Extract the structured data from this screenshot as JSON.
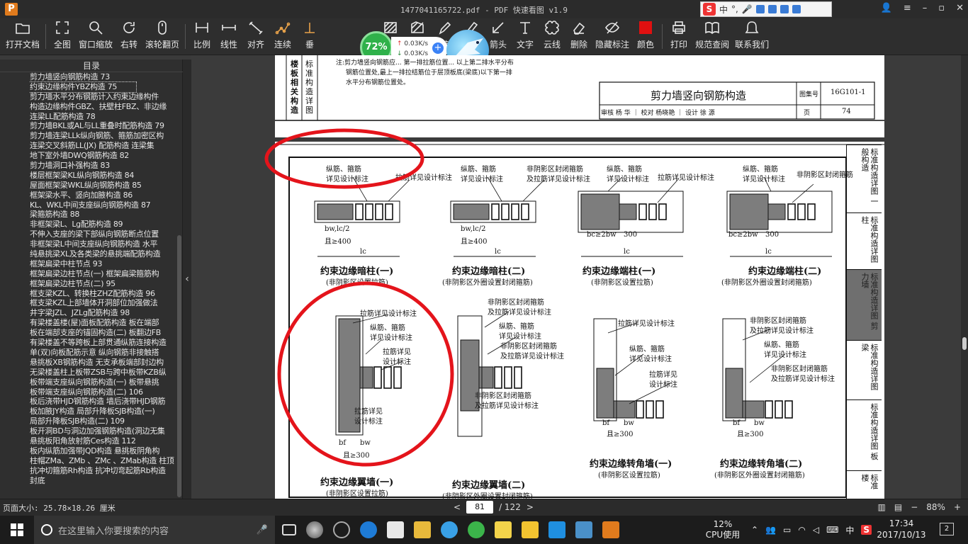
{
  "app": {
    "logo": "P",
    "title": "1477041165722.pdf - PDF 快速看图 v1.9"
  },
  "ime": {
    "brand": "S",
    "mode": "中",
    "punct": "°,"
  },
  "toolbar": {
    "buttons": [
      {
        "label": "打开文档",
        "icon": "folder-icon"
      },
      {
        "label": "全图",
        "icon": "fit-all-icon"
      },
      {
        "label": "窗口缩放",
        "icon": "zoom-window-icon"
      },
      {
        "label": "右转",
        "icon": "rotate-right-icon"
      },
      {
        "label": "滚轮翻页",
        "icon": "mouse-wheel-icon"
      },
      {
        "label": "比例",
        "icon": "scale-icon"
      },
      {
        "label": "线性",
        "icon": "linear-measure-icon"
      },
      {
        "label": "对齐",
        "icon": "align-measure-icon"
      },
      {
        "label": "连续",
        "icon": "continuous-measure-icon"
      },
      {
        "label": "垂",
        "icon": "perpendicular-icon"
      },
      {
        "label": "角度",
        "icon": "angle-icon"
      },
      {
        "label": "弧长",
        "icon": "arc-length-icon"
      },
      {
        "label": "面积",
        "icon": "area-icon"
      },
      {
        "label": "异形",
        "icon": "irregular-shape-icon"
      },
      {
        "label": "画笔",
        "icon": "pen-icon"
      },
      {
        "label": "高亮",
        "icon": "highlighter-icon"
      },
      {
        "label": "箭头",
        "icon": "arrow-icon"
      },
      {
        "label": "文字",
        "icon": "text-icon"
      },
      {
        "label": "云线",
        "icon": "cloud-line-icon"
      },
      {
        "label": "删除",
        "icon": "eraser-icon"
      },
      {
        "label": "隐藏标注",
        "icon": "hide-annotation-icon"
      },
      {
        "label": "颜色",
        "icon": "color-icon"
      },
      {
        "label": "打印",
        "icon": "printer-icon"
      },
      {
        "label": "规范查阅",
        "icon": "book-icon"
      },
      {
        "label": "联系我们",
        "icon": "contact-icon"
      }
    ],
    "color_value": "#e01010"
  },
  "speed_widget": {
    "percent": "72%",
    "up": "0.03K/s",
    "down": "0.03K/s",
    "plus": "+"
  },
  "sidebar": {
    "title": "目录",
    "items": [
      "剪力墙竖向钢筋构造 73",
      "约束边缘构件YBZ构造 75",
      "剪力墙水平分布钢筋计入约束边缘构件",
      "构造边缘构件GBZ、扶壁柱FBZ、非边缘",
      "连梁LL配筋构造 78",
      "剪力墙BKL或AL与LL重叠时配筋构造 79",
      "剪力墙连梁LLk纵向钢筋、箍筋加密区构",
      "连梁交叉斜筋LL(JX) 配筋构造 连梁集",
      "地下室外墙DWQ钢筋构造 82",
      "剪力墙洞口补强构造 83",
      "楼层框架梁KL纵向钢筋构造 84",
      "屋面框架梁WKL纵向钢筋构造 85",
      "框架梁水平、竖向加腋构造 86",
      "KL、WKL中间支座纵向钢筋构造 87",
      "梁箍筋构造 88",
      "非框架梁L、Lg配筋构造 89",
      "不伸入支座的梁下部纵向钢筋断点位置",
      "非框架梁L中间支座纵向钢筋构造 水平",
      "纯悬挑梁XL及各类梁的悬挑端配筋构造",
      "框架扁梁中柱节点 93",
      "框架扁梁边柱节点(一) 框架扁梁箍筋构",
      "框架扁梁边柱节点(二) 95",
      "框支梁KZL、转换柱ZHZ配筋构造 96",
      "框支梁KZL上部墙体开洞部位加强做法",
      "井字梁JZL、JZLg配筋构造 98",
      "有梁楼盖楼(屋)面板配筋构造 板在端部",
      "板在端部支座的锚固构造(二) 板翻边FB",
      "有梁楼盖不等跨板上部贯通纵筋连接构造",
      "单(双)向板配筋示意 纵向钢筋非接触搭",
      "悬挑板XB钢筋构造 无支承板端部封边构",
      "无梁楼盖柱上板带ZSB与跨中板带KZB纵",
      "板带端支座纵向钢筋构造(一) 板带悬挑",
      "板带端支座纵向钢筋构造(二) 106",
      "板后浇带HJD钢筋构造 墙后浇带HJD钢筋",
      "板加腋JY构造 局部升降板SJB构造(一)",
      "局部升降板SJB构造(二) 109",
      "板开洞BD与洞边加强钢筋构造(洞边无集",
      "悬挑板阳角放射筋Ces构造 112",
      "板内纵筋加强带JQD构造 悬挑板阴角构",
      "柱帽ZMa、ZMb 、ZMc 、ZMab构造 柱顶",
      "抗冲切箍筋Rh构造 抗冲切弯起筋Rb构造",
      "封底"
    ],
    "selected_index": 1
  },
  "doc_top": {
    "side_label": "楼板相关构造",
    "side_label2": "标准构造详图",
    "note_line1": "注:剪力墙竖向钢筋应... 第一排拉筋位置... 以上第二排水平分布",
    "note_line2": "钢筋位置处,最上一排拉结筋位于层顶板底(梁底)以下第一排",
    "note_line3": "水平分布钢筋位置处。",
    "title": "剪力墙竖向钢筋构造",
    "atlas_label": "图集号",
    "atlas_no": "16G101-1",
    "page_label": "页",
    "page_no": "74",
    "sign_row": "审核 杨 华 ｜ 校对 杨晓艳 ｜ 设计 徐 源"
  },
  "doc_main": {
    "sidebar_tabs": [
      "标准构造详图 一般构造",
      "标准构造详图 柱",
      "标准构造详图 剪力墙",
      "标准构造详图 梁",
      "标准构造详图 板",
      "标准 楼"
    ],
    "labels": {
      "long_stirrup": "纵筋、箍筋",
      "see_design": "详见设计标注",
      "tie_see": "拉筋详见设计标注",
      "closed_hoop": "非阴影区封闭箍筋",
      "closed_hoop2": "及拉筋详见设计标注",
      "b_w_lc2": "bw,lc/2",
      "ge400": "且≥400",
      "lc": "lc",
      "bc_2bw": "bc≥2bw",
      "ge300": "300",
      "tie_see2": "拉筋详见",
      "design_mark": "设计标注",
      "bf": "bf",
      "bw": "bw",
      "ge300b": "且≥300"
    },
    "captions": [
      {
        "title": "约束边缘暗柱(一)",
        "sub": "(非阴影区设置拉筋)"
      },
      {
        "title": "约束边缘暗柱(二)",
        "sub": "(非阴影区外圈设置封闭箍筋)"
      },
      {
        "title": "约束边缘端柱(一)",
        "sub": "(非阴影区设置拉筋)"
      },
      {
        "title": "约束边缘端柱(二)",
        "sub": "(非阴影区外圈设置封闭箍筋)"
      },
      {
        "title": "约束边缘翼墙(一)",
        "sub": "(非阴影区设置拉筋)"
      },
      {
        "title": "约束边缘翼墙(二)",
        "sub": "(非阴影区外圈设置封闭箍筋)"
      },
      {
        "title": "约束边缘转角墙(一)",
        "sub": "(非阴影区设置拉筋)"
      },
      {
        "title": "约束边缘转角墙(二)",
        "sub": "(非阴影区外圈设置封闭箍筋)"
      }
    ],
    "annotation_color": "#e4141b"
  },
  "statusbar": {
    "page_size": "页面大小: 25.78×18.26 厘米",
    "prev": "<",
    "current_page": "81",
    "total": "/ 122",
    "next": ">",
    "zoom_minus": "−",
    "zoom": "88%",
    "zoom_plus": "+"
  },
  "taskbar": {
    "search_placeholder": "在这里输入你要搜索的内容",
    "cpu_percent": "12%",
    "cpu_label": "CPU使用",
    "ime": "中",
    "time": "17:34",
    "date": "2017/10/13",
    "notifications": "2"
  }
}
